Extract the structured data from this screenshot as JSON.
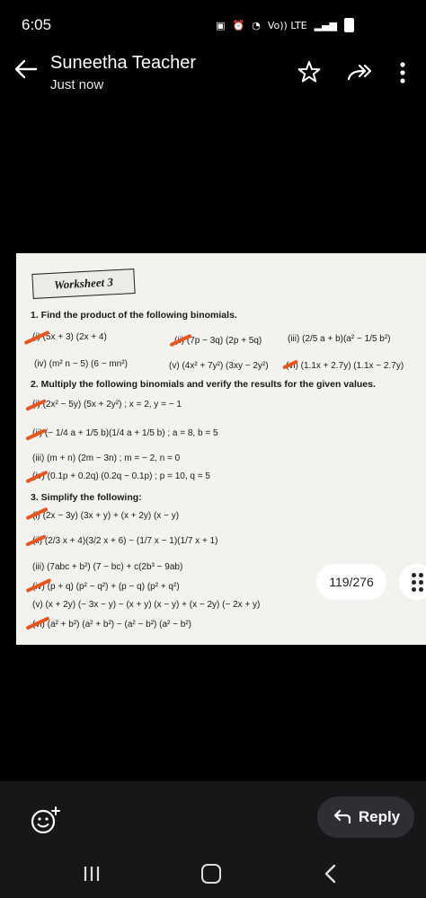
{
  "status_bar": {
    "time": "6:05",
    "network": "Vo)) LTE"
  },
  "header": {
    "sender": "Suneetha Teacher",
    "subtitle": "Just now"
  },
  "worksheet": {
    "title": "Worksheet 3",
    "lines": [
      {
        "text": "1.  Find the product of the following binomials.",
        "heading": true
      },
      {
        "text": "(i)  (5x + 3) (2x + 4)",
        "heading": false
      },
      {
        "text": "(ii)  (7p − 3q) (2p + 5q)",
        "heading": false
      },
      {
        "text": "(iii)  (2/5 a + b)(a² − 1/5 b²)",
        "heading": false
      },
      {
        "text": "(iv)  (m² n − 5) (6 − mn²)",
        "heading": false
      },
      {
        "text": "(v)  (4x² + 7y²) (3xy − 2y²)",
        "heading": false
      },
      {
        "text": "(vi)  (1.1x + 2.7y) (1.1x − 2.7y)",
        "heading": false
      },
      {
        "text": "2.  Multiply the following binomials and verify the results for the given values.",
        "heading": true
      },
      {
        "text": "(i)  (2x² − 5y) (5x + 2y²) ; x = 2, y = − 1",
        "heading": false
      },
      {
        "text": "(ii)  (− 1/4 a + 1/5 b)(1/4 a + 1/5 b) ; a = 8, b = 5",
        "heading": false
      },
      {
        "text": "(iii)  (m + n) (2m − 3n) ; m = − 2, n = 0",
        "heading": false
      },
      {
        "text": "(iv)  (0.1p + 0.2q) (0.2q − 0.1p) ; p = 10, q = 5",
        "heading": false
      },
      {
        "text": "3.  Simplify the following:",
        "heading": true
      },
      {
        "text": "(i)  (2x − 3y) (3x + y) + (x + 2y) (x − y)",
        "heading": false
      },
      {
        "text": "(ii)  (2/3 x + 4)(3/2 x + 6) − (1/7 x − 1)(1/7 x + 1)",
        "heading": false
      },
      {
        "text": "(iii)  (7abc + b²) (7 − bc) + c(2b³ − 9ab)",
        "heading": false
      },
      {
        "text": "(iv)  (p + q) (p² − q²) + (p − q) (p² + q²)",
        "heading": false
      },
      {
        "text": "(v)  (x + 2y) (− 3x − y) − (x + y) (x − y) + (x − 2y) (− 2x + y)",
        "heading": false
      },
      {
        "text": "(vi)  (a² + b²) (a² + b²) − (a² − b²) (a² − b²)",
        "heading": false
      }
    ]
  },
  "pager": {
    "label": "119/276"
  },
  "footer": {
    "reply_label": "Reply"
  },
  "colors": {
    "tick": "#e8561d",
    "paper": "#f3f2ee",
    "reply_bg": "#2e2f33"
  }
}
